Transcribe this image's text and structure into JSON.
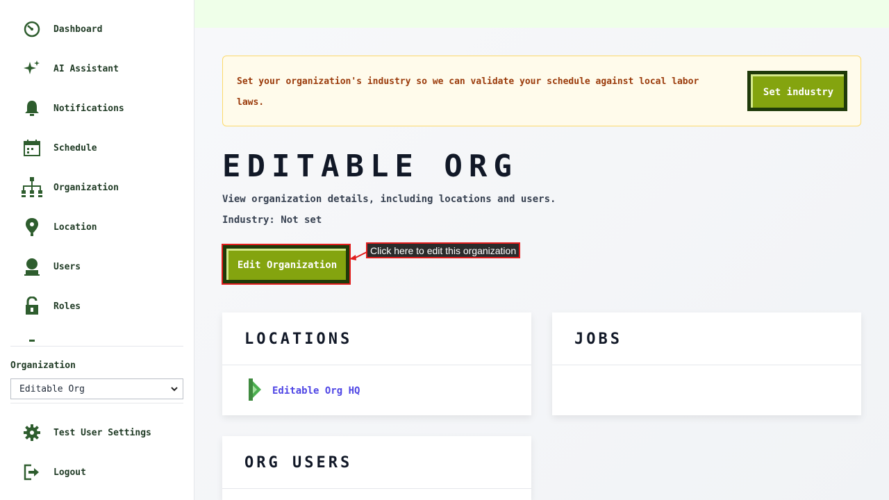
{
  "sidebar": {
    "items": [
      {
        "label": "Dashboard",
        "icon": "dashboard-icon"
      },
      {
        "label": "AI Assistant",
        "icon": "sparkle-icon"
      },
      {
        "label": "Notifications",
        "icon": "bell-icon"
      },
      {
        "label": "Schedule",
        "icon": "calendar-icon"
      },
      {
        "label": "Organization",
        "icon": "org-chart-icon"
      },
      {
        "label": "Location",
        "icon": "location-pin-icon"
      },
      {
        "label": "Users",
        "icon": "user-icon"
      },
      {
        "label": "Roles",
        "icon": "unlock-icon"
      }
    ],
    "org_label": "Organization",
    "org_selected": "Editable Org",
    "settings_label": "Test User Settings",
    "logout_label": "Logout"
  },
  "banner": {
    "text": "Set your organization's industry so we can validate your schedule against local labor laws.",
    "button_label": "Set industry"
  },
  "page": {
    "title": "EDITABLE ORG",
    "description": "View organization details, including locations and users.",
    "industry": "Industry: Not set",
    "edit_button_label": "Edit Organization",
    "tooltip": "Click here to edit this organization"
  },
  "cards": {
    "locations_title": "LOCATIONS",
    "jobs_title": "JOBS",
    "org_users_title": "ORG USERS",
    "locations": [
      "Editable Org HQ"
    ]
  },
  "colors": {
    "sidebar_icon": "#2e5d2e",
    "button_green": "#84a40f",
    "button_dark": "#1f3a0a",
    "link": "#4f46e5",
    "highlight": "#e11d1d"
  }
}
